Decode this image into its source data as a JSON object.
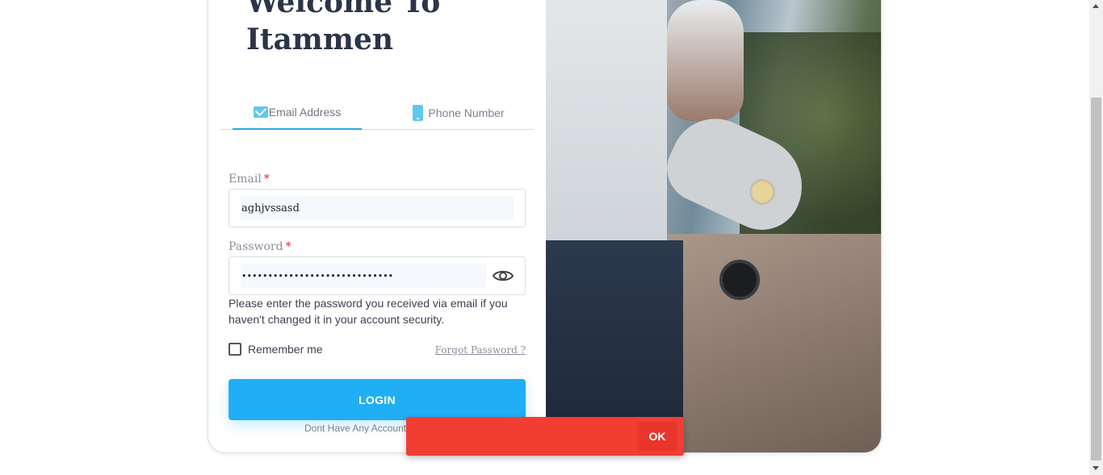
{
  "header": {
    "title": "Welcome To Itammen"
  },
  "tabs": [
    {
      "label": "Email Address",
      "icon": "mail-icon",
      "active": true
    },
    {
      "label": "Phone Number",
      "icon": "phone-icon",
      "active": false
    }
  ],
  "form": {
    "email_label": "Email",
    "email_value": "aghjvssasd",
    "password_label": "Password",
    "password_value": "•••••••••••••••••••••••••••••",
    "required_mark": "*",
    "hint": "Please enter the password you received via email if you haven't changed it in your account security.",
    "remember_label": "Remember me",
    "forgot_label": "Forgot Password ?",
    "login_label": "LOGIN",
    "signup_text": "Dont Have Any Account"
  },
  "snackbar": {
    "ok_label": "OK"
  },
  "colors": {
    "accent": "#20aef5",
    "error": "#f23d33",
    "tab_underline": "#2aa7e6"
  }
}
